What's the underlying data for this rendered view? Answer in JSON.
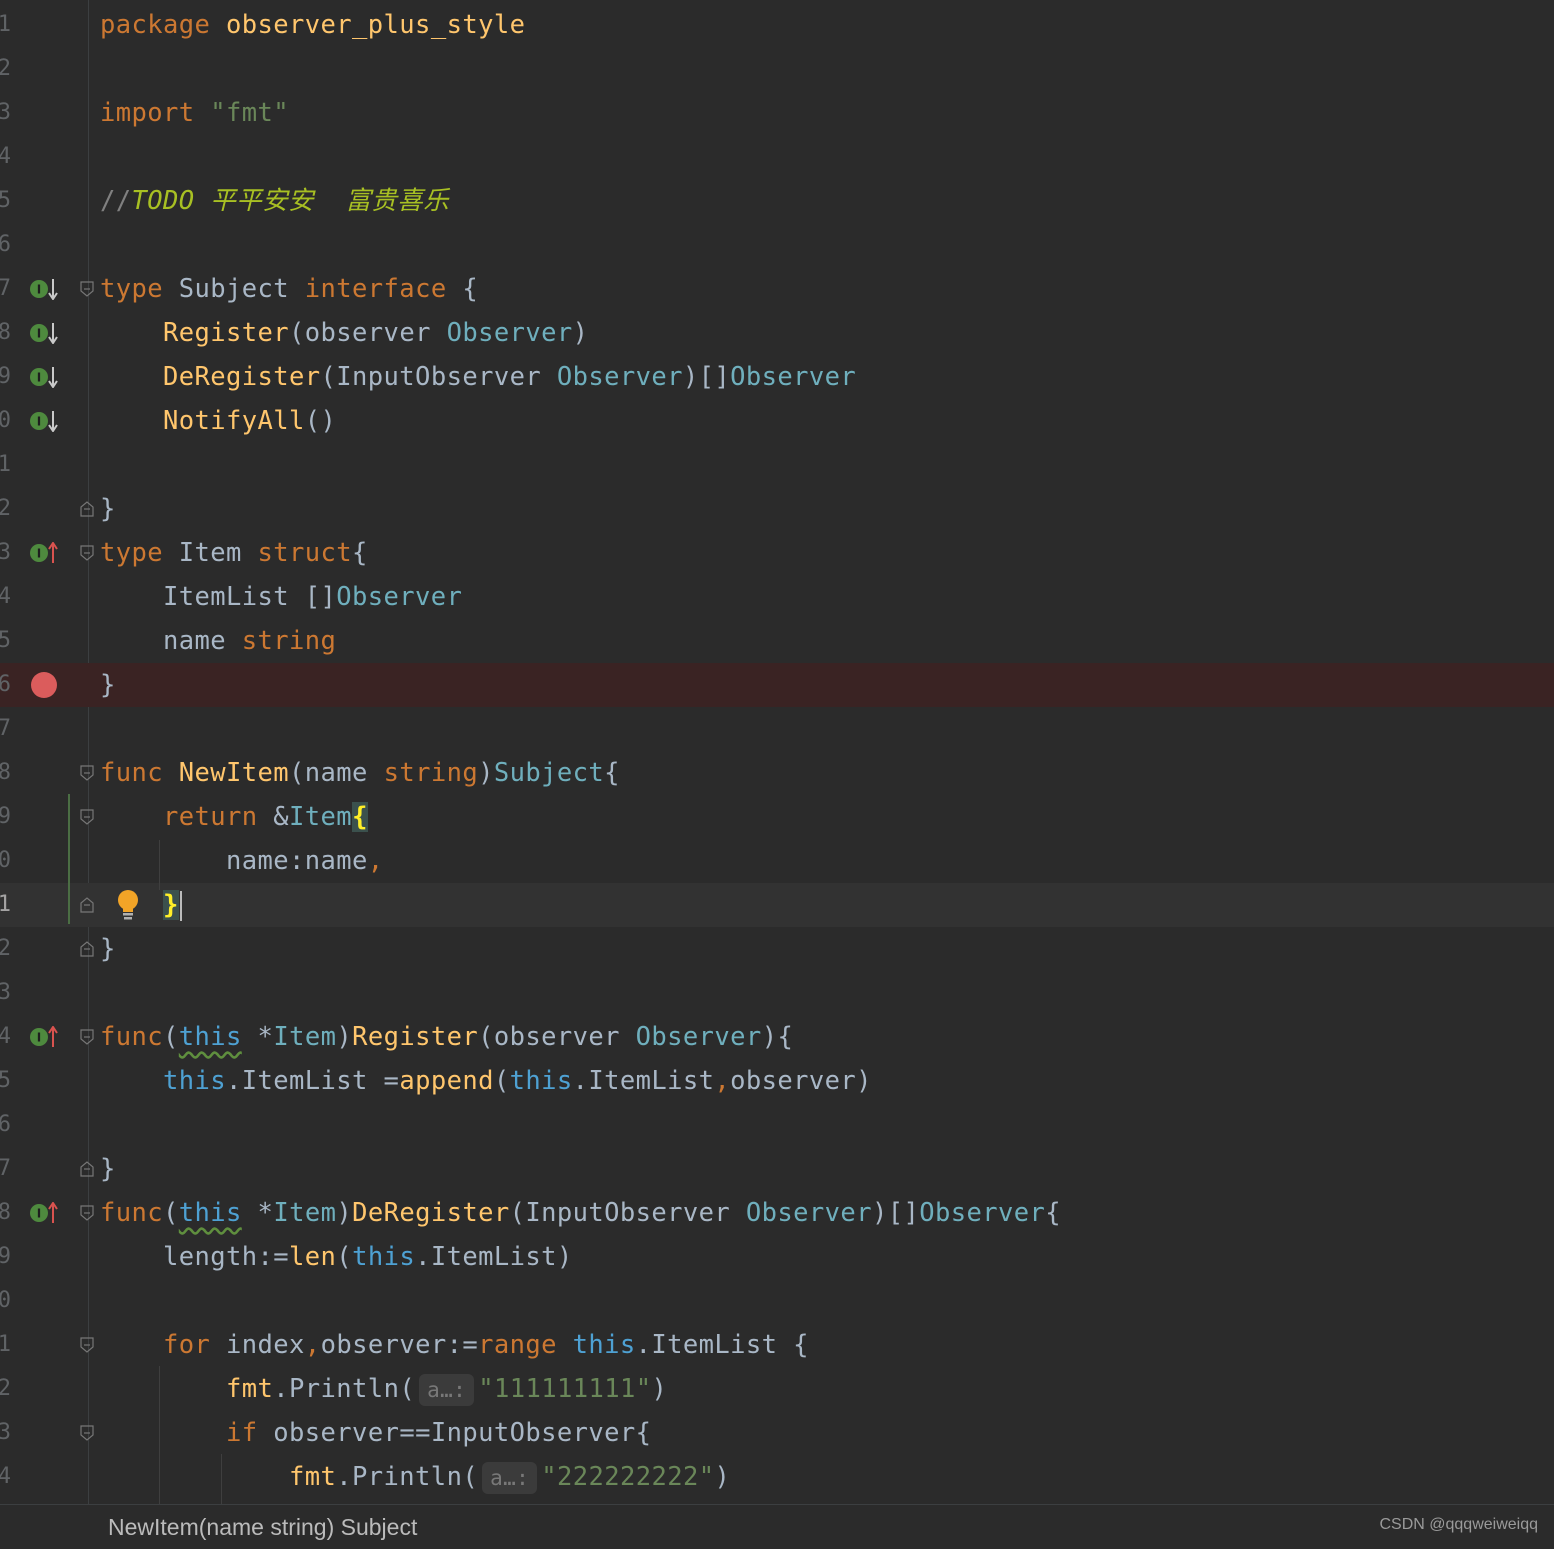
{
  "editor": {
    "lines": [
      {
        "num": "1",
        "tokens": [
          [
            "kw",
            "package"
          ],
          [
            "",
            ""
          ],
          [
            "fn",
            " observer_plus_style"
          ]
        ]
      },
      {
        "num": "2",
        "tokens": []
      },
      {
        "num": "3",
        "tokens": [
          [
            "kw",
            "import"
          ],
          [
            "",
            " "
          ],
          [
            "str",
            "\"fmt\""
          ]
        ]
      },
      {
        "num": "4",
        "tokens": []
      },
      {
        "num": "5",
        "tokens": [
          [
            "cm",
            "//"
          ],
          [
            "todo",
            "TODO 平平安安  富贵喜乐"
          ]
        ]
      },
      {
        "num": "6",
        "tokens": []
      },
      {
        "num": "7",
        "tokens": [
          [
            "kw",
            "type"
          ],
          [
            "",
            " Subject "
          ],
          [
            "kw",
            "interface"
          ],
          [
            "",
            " {"
          ]
        ]
      },
      {
        "num": "8",
        "tokens": [
          [
            "",
            "    "
          ],
          [
            "fn",
            "Register"
          ],
          [
            "",
            "(observer "
          ],
          [
            "typ",
            "Observer"
          ],
          [
            "",
            ")"
          ]
        ]
      },
      {
        "num": "9",
        "tokens": [
          [
            "",
            "    "
          ],
          [
            "fn",
            "DeRegister"
          ],
          [
            "",
            "(InputObserver "
          ],
          [
            "typ",
            "Observer"
          ],
          [
            "",
            ")[]"
          ],
          [
            "typ",
            "Observer"
          ]
        ]
      },
      {
        "num": "0",
        "tokens": [
          [
            "",
            "    "
          ],
          [
            "fn",
            "NotifyAll"
          ],
          [
            "",
            "()"
          ]
        ]
      },
      {
        "num": "1",
        "tokens": []
      },
      {
        "num": "2",
        "tokens": [
          [
            "",
            "}"
          ]
        ]
      },
      {
        "num": "3",
        "tokens": [
          [
            "kw",
            "type"
          ],
          [
            "",
            " Item "
          ],
          [
            "kw",
            "struct"
          ],
          [
            "",
            "{"
          ]
        ]
      },
      {
        "num": "4",
        "tokens": [
          [
            "",
            "    ItemList []"
          ],
          [
            "typ",
            "Observer"
          ]
        ]
      },
      {
        "num": "5",
        "tokens": [
          [
            "",
            "    name "
          ],
          [
            "kw",
            "string"
          ]
        ]
      },
      {
        "num": "6",
        "tokens": [
          [
            "",
            "}"
          ]
        ]
      },
      {
        "num": "7",
        "tokens": []
      },
      {
        "num": "8",
        "tokens": [
          [
            "kw",
            "func"
          ],
          [
            "fn",
            " NewItem"
          ],
          [
            "",
            "(name "
          ],
          [
            "kw",
            "string"
          ],
          [
            "",
            ")"
          ],
          [
            "typ",
            "Subject"
          ],
          [
            "",
            "{"
          ]
        ]
      },
      {
        "num": "9",
        "tokens": [
          [
            "",
            "    "
          ],
          [
            "kw",
            "return"
          ],
          [
            "",
            " &"
          ],
          [
            "typ",
            "Item"
          ],
          [
            "brace-match",
            "{"
          ]
        ]
      },
      {
        "num": "0",
        "tokens": [
          [
            "",
            "        name:name"
          ],
          [
            "kw",
            ","
          ]
        ]
      },
      {
        "num": "1",
        "tokens": [
          [
            "",
            "    "
          ],
          [
            "brace-match",
            "}"
          ],
          [
            "caret",
            ""
          ]
        ]
      },
      {
        "num": "2",
        "tokens": [
          [
            "",
            "}"
          ]
        ]
      },
      {
        "num": "3",
        "tokens": []
      },
      {
        "num": "4",
        "tokens": [
          [
            "kw",
            "func"
          ],
          [
            "",
            "("
          ],
          [
            "this squig",
            "this"
          ],
          [
            "",
            " *"
          ],
          [
            "typ",
            "Item"
          ],
          [
            "",
            ")"
          ],
          [
            "fn",
            "Register"
          ],
          [
            "",
            "(observer "
          ],
          [
            "typ",
            "Observer"
          ],
          [
            "",
            "){"
          ]
        ]
      },
      {
        "num": "5",
        "tokens": [
          [
            "",
            "    "
          ],
          [
            "this",
            "this"
          ],
          [
            "",
            ".ItemList ="
          ],
          [
            "fn",
            "append"
          ],
          [
            "",
            "("
          ],
          [
            "this",
            "this"
          ],
          [
            "",
            ".ItemList"
          ],
          [
            "kw",
            ","
          ],
          [
            "",
            "observer)"
          ]
        ]
      },
      {
        "num": "6",
        "tokens": []
      },
      {
        "num": "7",
        "tokens": [
          [
            "",
            "}"
          ]
        ]
      },
      {
        "num": "8",
        "tokens": [
          [
            "kw",
            "func"
          ],
          [
            "",
            "("
          ],
          [
            "this squig",
            "this"
          ],
          [
            "",
            " *"
          ],
          [
            "typ",
            "Item"
          ],
          [
            "",
            ")"
          ],
          [
            "fn",
            "DeRegister"
          ],
          [
            "",
            "(InputObserver "
          ],
          [
            "typ",
            "Observer"
          ],
          [
            "",
            ")[]"
          ],
          [
            "typ",
            "Observer"
          ],
          [
            "",
            "{"
          ]
        ]
      },
      {
        "num": "9",
        "tokens": [
          [
            "",
            "    length:="
          ],
          [
            "fn",
            "len"
          ],
          [
            "",
            "("
          ],
          [
            "this",
            "this"
          ],
          [
            "",
            ".ItemList)"
          ]
        ]
      },
      {
        "num": "0",
        "tokens": []
      },
      {
        "num": "1",
        "tokens": [
          [
            "",
            "    "
          ],
          [
            "kw",
            "for"
          ],
          [
            "",
            " index"
          ],
          [
            "kw",
            ","
          ],
          [
            "",
            "observer:="
          ],
          [
            "kw",
            "range"
          ],
          [
            "",
            " "
          ],
          [
            "this",
            "this"
          ],
          [
            "",
            ".ItemList {"
          ]
        ]
      },
      {
        "num": "2",
        "tokens": [
          [
            "",
            "        "
          ],
          [
            "fn",
            "fmt"
          ],
          [
            "",
            ".Println("
          ],
          [
            "hint",
            "a…:"
          ],
          [
            "str",
            "\"111111111\""
          ],
          [
            "",
            ")"
          ]
        ]
      },
      {
        "num": "3",
        "tokens": [
          [
            "",
            "        "
          ],
          [
            "kw",
            "if"
          ],
          [
            "",
            " observer==InputObserver{"
          ]
        ]
      },
      {
        "num": "4",
        "tokens": [
          [
            "",
            "            "
          ],
          [
            "fn",
            "fmt"
          ],
          [
            "",
            ".Println("
          ],
          [
            "hint",
            "a…:"
          ],
          [
            "str",
            "\"222222222\""
          ],
          [
            "",
            ")"
          ]
        ]
      }
    ]
  },
  "status": {
    "breadcrumb": "NewItem(name string) Subject",
    "watermark": "CSDN @qqqweiweiqq"
  },
  "colors": {
    "background": "#2b2b2b",
    "keyword": "#cc7832",
    "function": "#ffc66d",
    "type": "#6fafbd",
    "string": "#6a8759",
    "breakpoint": "#db5c5c"
  }
}
